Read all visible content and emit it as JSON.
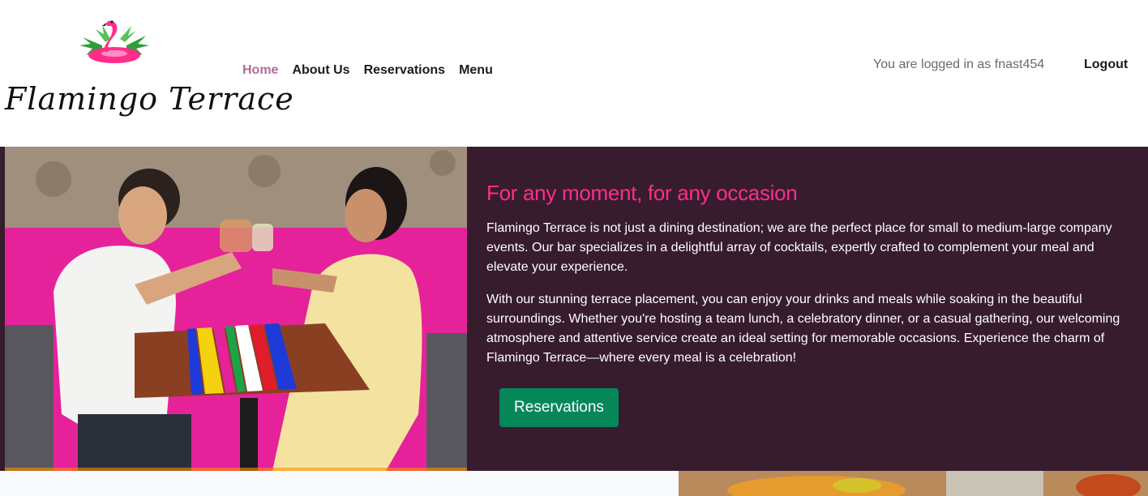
{
  "header": {
    "brand_name": "Flamingo Terrace",
    "nav": [
      {
        "label": "Home",
        "active": true
      },
      {
        "label": "About Us",
        "active": false
      },
      {
        "label": "Reservations",
        "active": false
      },
      {
        "label": "Menu",
        "active": false
      }
    ],
    "login_status": "You are logged in as fnast454",
    "logout_label": "Logout"
  },
  "hero": {
    "heading": "For any moment, for any occasion",
    "paragraphs": [
      "Flamingo Terrace is not just a dining destination; we are the perfect place for small to medium-large company events. Our bar specializes in a delightful array of cocktails, expertly crafted to complement your meal and elevate your experience.",
      "With our stunning terrace placement, you can enjoy your drinks and meals while soaking in the beautiful surroundings. Whether you're hosting a team lunch, a celebratory dinner, or a casual gathering, our welcoming atmosphere and attentive service create an ideal setting for memorable occasions. Experience the charm of Flamingo Terrace—where every meal is a celebration!"
    ],
    "button_label": "Reservations"
  },
  "icons": {
    "logo": "flamingo-float-icon"
  },
  "colors": {
    "hero_bg": "#371c2e",
    "accent_pink": "#ff2d8a",
    "nav_active": "#b36b99",
    "button_green": "#06875a"
  }
}
